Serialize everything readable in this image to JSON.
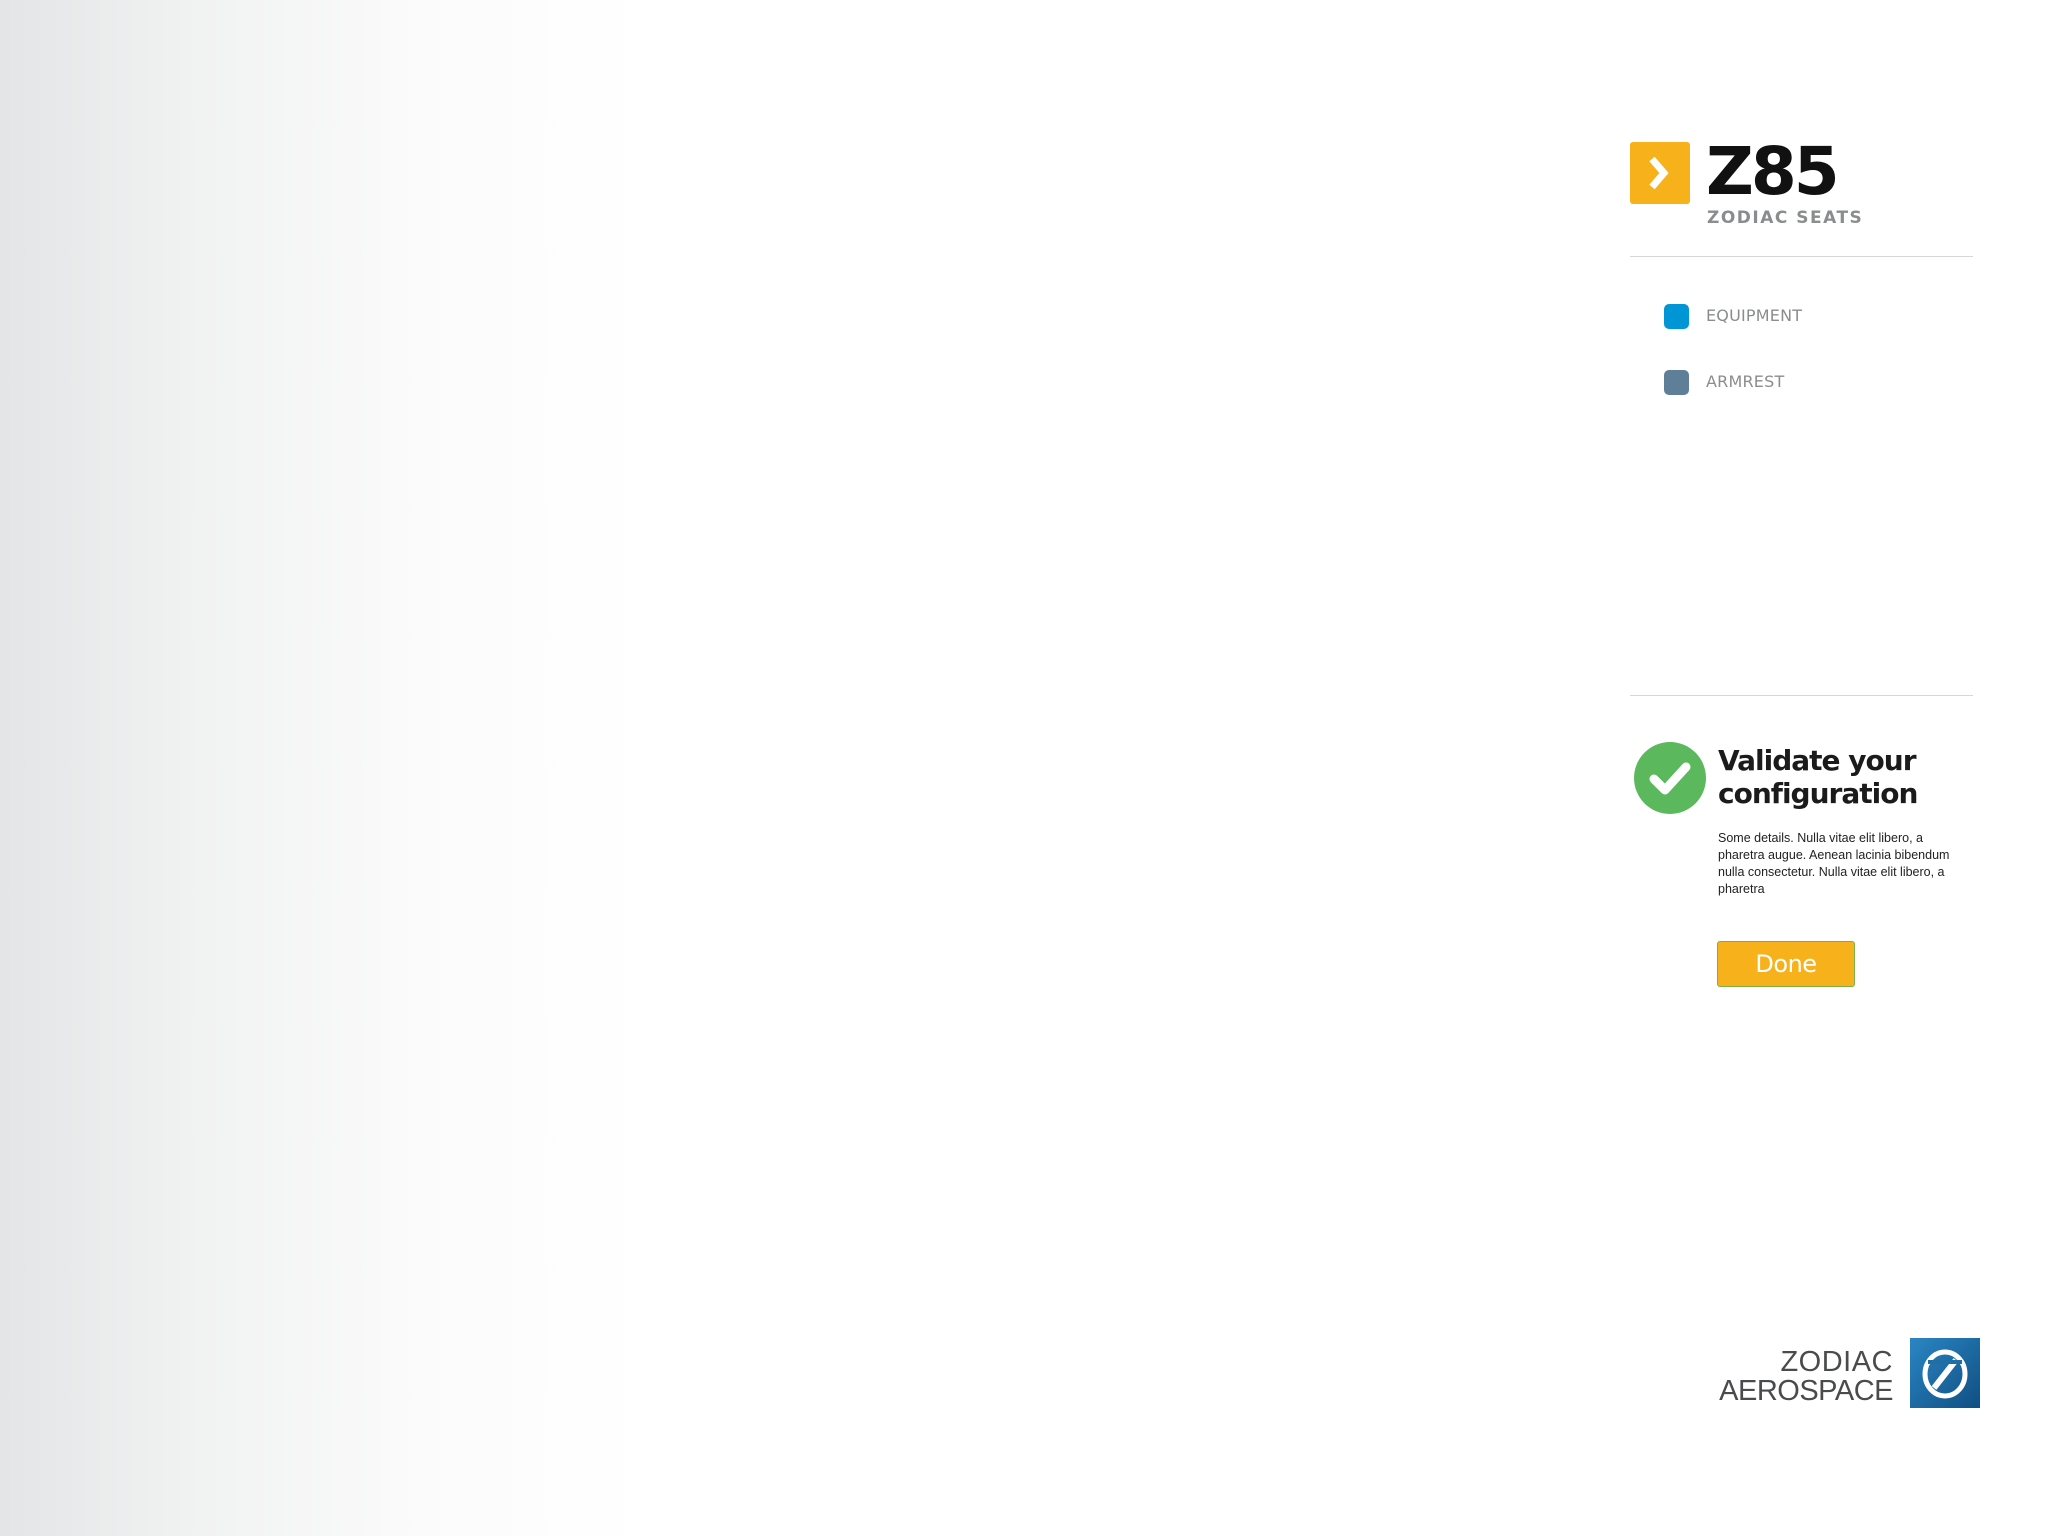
{
  "brand": {
    "title": "Z85",
    "subtitle": "ZODIAC SEATS",
    "badge_icon": "chevron-right-icon",
    "badge_color": "#f7b21b"
  },
  "options": [
    {
      "label": "EQUIPMENT",
      "color": "#0096d6"
    },
    {
      "label": "ARMREST",
      "color": "#5e7f97"
    }
  ],
  "validate": {
    "icon": "checkmark-icon",
    "icon_color": "#5cb85c",
    "title_line1": "Validate your",
    "title_line2": "configuration",
    "description": "Some details. Nulla vitae elit libero, a pharetra augue. Aenean lacinia bibendum nulla consectetur. Nulla vitae elit libero, a pharetra",
    "done_label": "Done",
    "done_color": "#f7b21b"
  },
  "footer": {
    "logo_line1": "ZODIAC",
    "logo_line2": "AEROSPACE",
    "logo_mark_color": "#1a6fa8"
  }
}
